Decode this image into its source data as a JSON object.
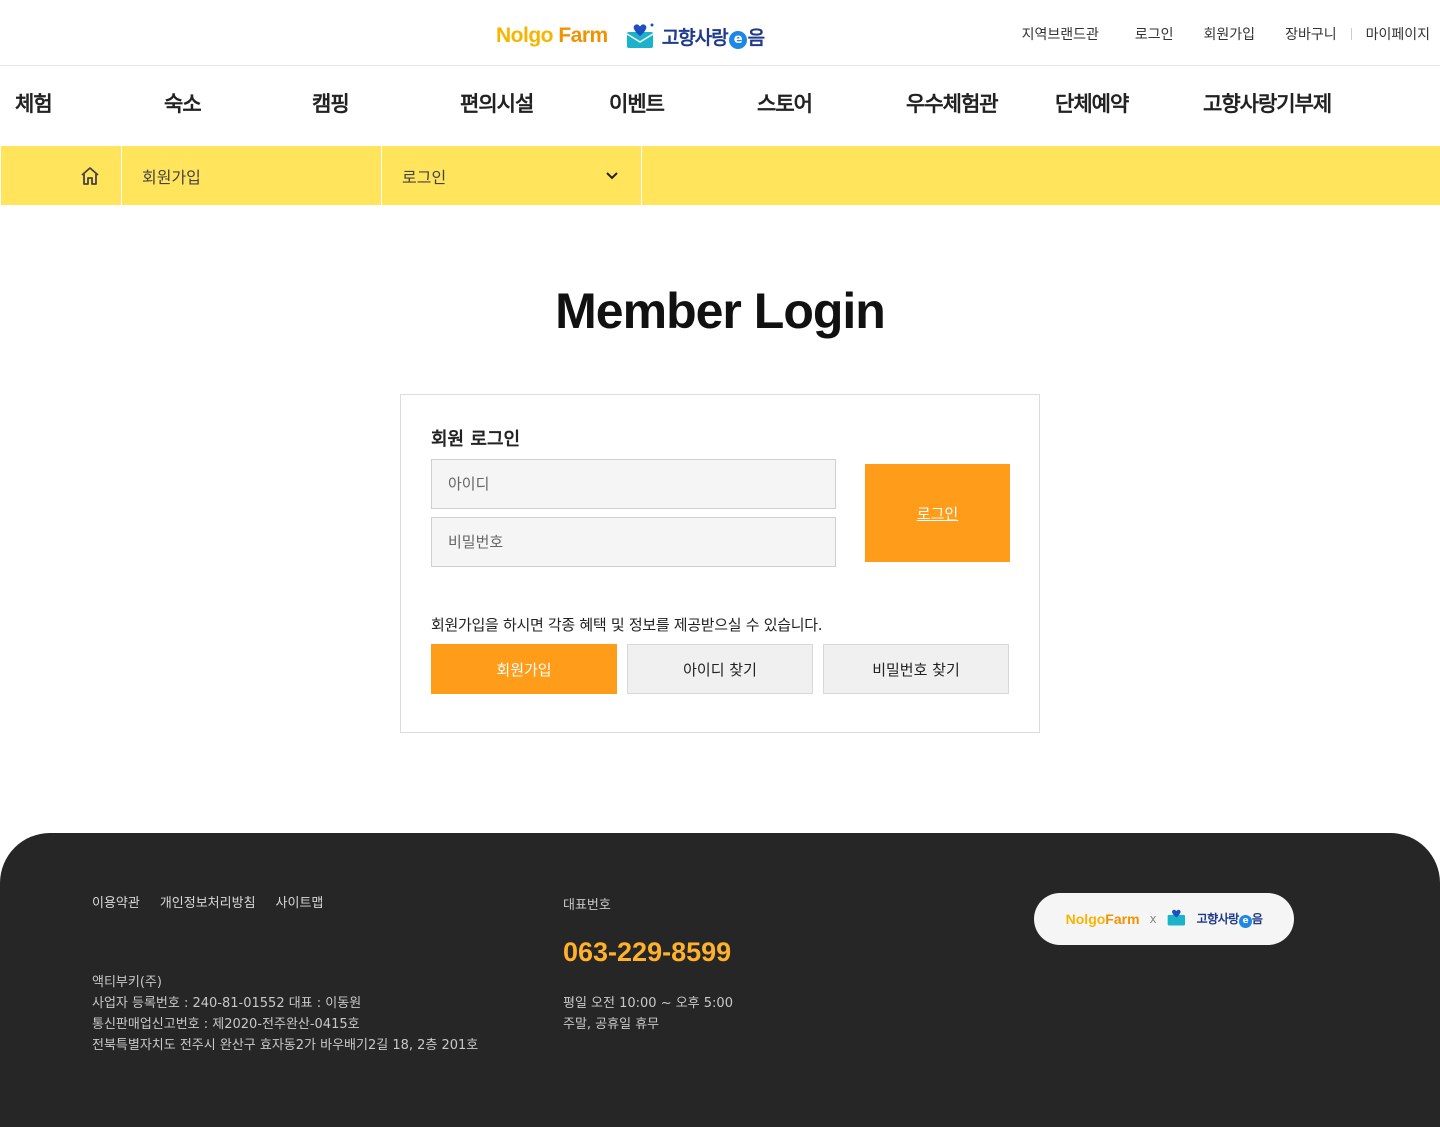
{
  "header": {
    "logo_nolgo_a": "Nolgo",
    "logo_nolgo_b": "Farm",
    "logo_gohyang_a": "고향사랑",
    "logo_gohyang_e": "e",
    "logo_gohyang_b": "음",
    "util_nav": [
      "지역브랜드관",
      "로그인",
      "회원가입",
      "장바구니",
      "마이페이지"
    ]
  },
  "gnb": [
    "체험",
    "숙소",
    "캠핑",
    "편의시설",
    "이벤트",
    "스토어",
    "우수체험관",
    "단체예약",
    "고향사랑기부제"
  ],
  "breadcrumb": {
    "home_icon": "home-icon",
    "level1": "회원가입",
    "level2": "로그인",
    "dropdown_icon": "chevron-down-icon"
  },
  "main": {
    "title": "Member Login",
    "box_heading": "회원 로그인",
    "id_placeholder": "아이디",
    "pw_placeholder": "비밀번호",
    "login_button": "로그인",
    "info_text": "회원가입을 하시면 각종 혜택 및 정보를 제공받으실 수 있습니다.",
    "join_button": "회원가입",
    "find_id_button": "아이디 찾기",
    "find_pw_button": "비밀번호 찾기"
  },
  "footer": {
    "links": [
      "이용약관",
      "개인정보처리방침",
      "사이트맵"
    ],
    "company": [
      "액티부키(주)",
      "사업자 등록번호 : 240-81-01552 대표 : 이동원",
      "통신판매업신고번호 : 제2020-전주완산-0415호",
      "전북특별자치도 전주시 완산구 효자동2가 바우배기2길 18, 2층 201호"
    ],
    "tel_label": "대표번호",
    "tel": "063-229-8599",
    "hours": [
      "평일 오전 10:00 ~ 오후 5:00",
      "주말, 공휴일 휴무"
    ],
    "logo_x": "x"
  },
  "colors": {
    "accent_orange": "#ff9c1a",
    "breadcrumb_yellow": "#ffe45c",
    "footer_bg": "#262626",
    "tel_color": "#ffb12b",
    "brand_blue": "#1f3a8a"
  }
}
